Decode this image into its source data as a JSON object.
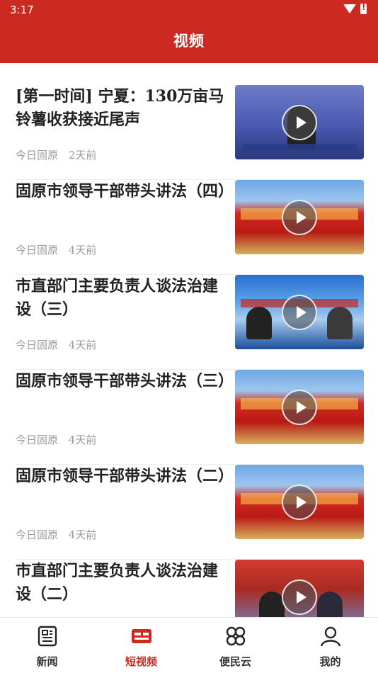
{
  "status_bar": {
    "time": "3:17"
  },
  "header": {
    "title": "视频"
  },
  "colors": {
    "brand": "#cc2a20",
    "meta_text": "#9a9a9a"
  },
  "videos": [
    {
      "title": "[第一时间] 宁夏：130万亩马铃薯收获接近尾声",
      "source": "今日固原",
      "time": "2天前",
      "thumb_style": "news"
    },
    {
      "title": "固原市领导干部带头讲法（四）",
      "source": "今日固原",
      "time": "4天前",
      "thumb_style": "law"
    },
    {
      "title": "市直部门主要负责人谈法治建设（三）",
      "source": "今日固原",
      "time": "4天前",
      "thumb_style": "talk"
    },
    {
      "title": "固原市领导干部带头讲法（三）",
      "source": "今日固原",
      "time": "4天前",
      "thumb_style": "law"
    },
    {
      "title": "固原市领导干部带头讲法（二）",
      "source": "今日固原",
      "time": "4天前",
      "thumb_style": "law"
    },
    {
      "title": "市直部门主要负责人谈法治建设（二）",
      "source": "",
      "time": "",
      "thumb_style": "talk2"
    }
  ],
  "tabs": [
    {
      "label": "新闻",
      "icon": "newspaper-icon",
      "active": false
    },
    {
      "label": "短视频",
      "icon": "video-card-icon",
      "active": true
    },
    {
      "label": "便民云",
      "icon": "cloud-service-icon",
      "active": false
    },
    {
      "label": "我的",
      "icon": "user-icon",
      "active": false
    }
  ]
}
